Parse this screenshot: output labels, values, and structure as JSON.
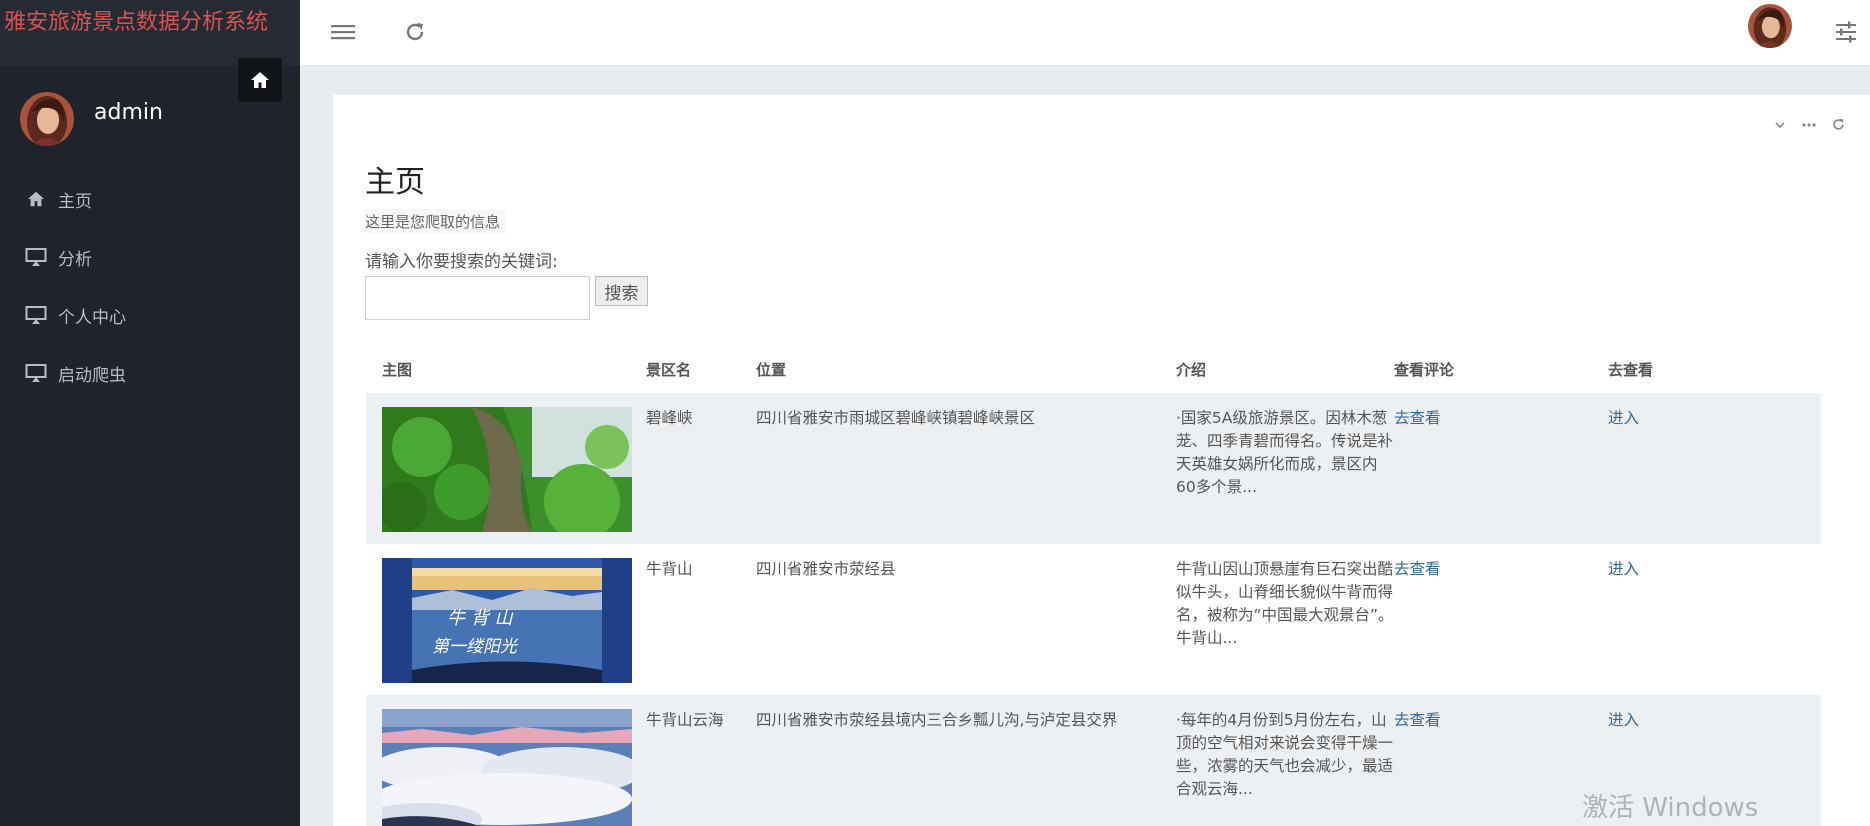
{
  "app": {
    "title": "雅安旅游景点数据分析系统",
    "username": "admin"
  },
  "sidebar": {
    "items": [
      {
        "label": "主页",
        "icon": "home-icon"
      },
      {
        "label": "分析",
        "icon": "monitor-icon"
      },
      {
        "label": "个人中心",
        "icon": "monitor-icon"
      },
      {
        "label": "启动爬虫",
        "icon": "monitor-icon"
      }
    ]
  },
  "topbar": {
    "menu_icon": "hamburger-icon",
    "refresh_icon": "refresh-icon",
    "settings_icon": "sliders-icon"
  },
  "main": {
    "title": "主页",
    "subtitle": "这里是您爬取的信息",
    "search_label": "请输入你要搜索的关键词:",
    "search_placeholder": "",
    "search_button": "搜索"
  },
  "table": {
    "headers": [
      "主图",
      "景区名",
      "位置",
      "介绍",
      "查看评论",
      "去查看"
    ],
    "rows": [
      {
        "image": "green-mountain-forest",
        "name": "碧峰峡",
        "location": "四川省雅安市雨城区碧峰峡镇碧峰峡景区",
        "intro": "·国家5A级旅游景区。因林木葱茏、四季青碧而得名。传说是补天英雄女娲所化而成，景区内60多个景...",
        "comments": "去查看",
        "go": "进入"
      },
      {
        "image": "mountain-sunrise-calligraphy",
        "name": "牛背山",
        "location": "四川省雅安市荥经县",
        "intro": "牛背山因山顶悬崖有巨石突出酷似牛头，山脊细长貌似牛背而得名，被称为“中国最大观景台”。 牛背山...",
        "comments": "去查看",
        "go": "进入"
      },
      {
        "image": "sea-of-clouds",
        "name": "牛背山云海",
        "location": "四川省雅安市荥经县境内三合乡瓢儿沟,与泸定县交界",
        "intro": "·每年的4月份到5月份左右，山顶的空气相对来说会变得干燥一些，浓雾的天气也会减少，最适合观云海...",
        "comments": "去查看",
        "go": "进入"
      }
    ]
  },
  "watermark": "激活 Windows"
}
